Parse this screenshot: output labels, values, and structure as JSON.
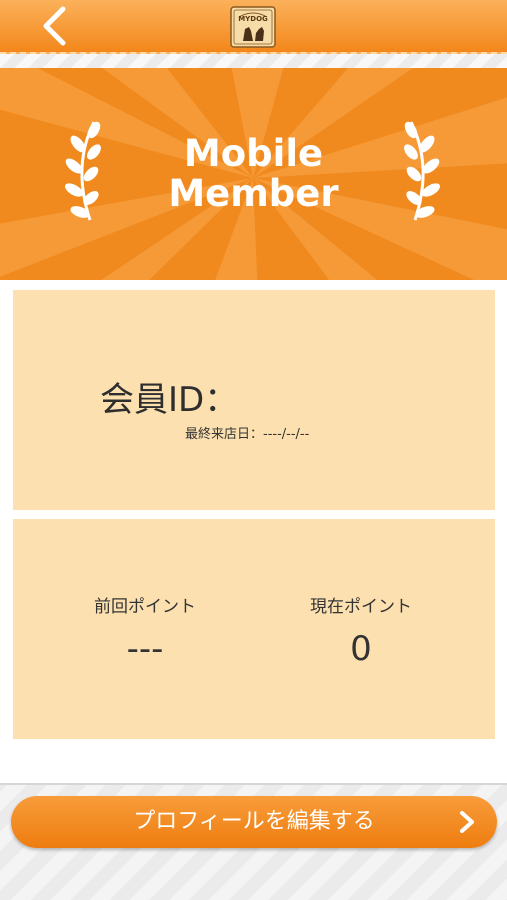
{
  "header": {
    "back_icon": "chevron-left-icon",
    "logo_text": "MYDOG",
    "accent": "#f3871b"
  },
  "banner": {
    "title_line1": "Mobile",
    "title_line2": "Member",
    "background": "#f08a1f",
    "icon_left": "laurel-left-icon",
    "icon_right": "laurel-right-icon"
  },
  "member": {
    "id_label": "会員ID：",
    "last_visit": "最終来店日：----/--/--"
  },
  "points": {
    "previous_label": "前回ポイント",
    "previous_value": "---",
    "current_label": "現在ポイント",
    "current_value": "0"
  },
  "footer": {
    "edit_profile_label": "プロフィールを編集する",
    "chevron_icon": "chevron-right-icon"
  }
}
